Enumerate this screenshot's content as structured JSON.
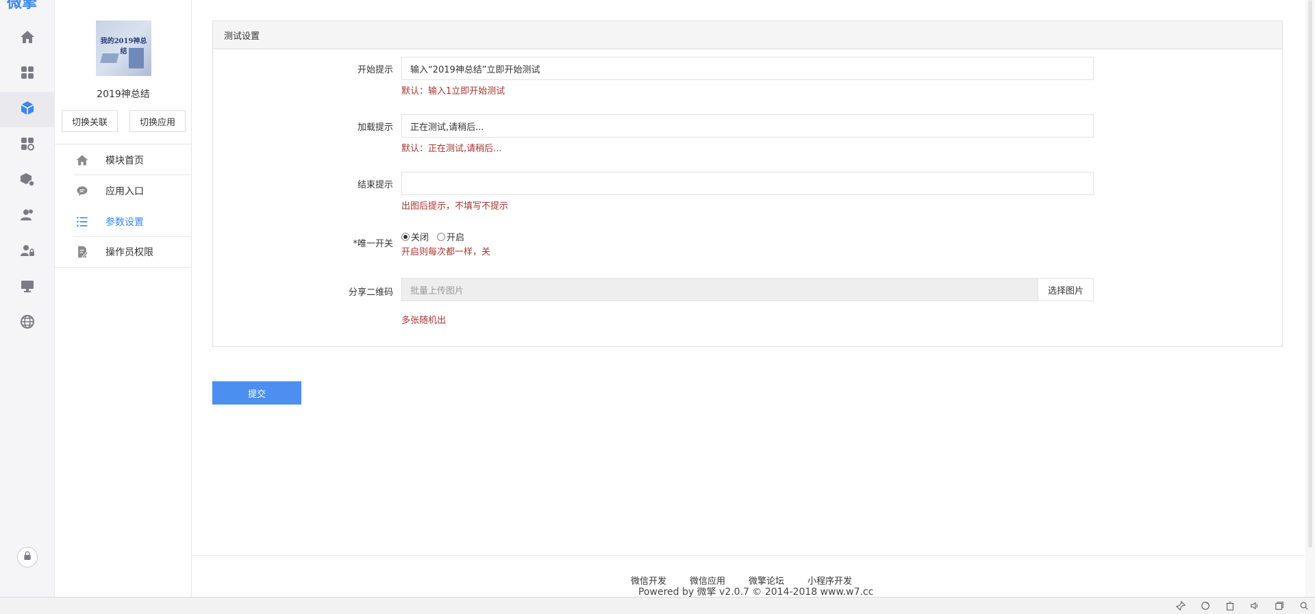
{
  "rail": {
    "logo_text": "微擎",
    "items": [
      "home",
      "apps",
      "module",
      "app-settings",
      "module-manage",
      "users",
      "user-security",
      "monitor",
      "globe"
    ]
  },
  "sidebar": {
    "module_name": "2019神总结",
    "thumb_text": "我的2019神总结",
    "switch_link_label": "切换关联",
    "switch_app_label": "切换应用",
    "nav": [
      {
        "label": "模块首页",
        "icon": "home-icon"
      },
      {
        "label": "应用入口",
        "icon": "chat-bubble-icon"
      },
      {
        "label": "参数设置",
        "icon": "list-settings-icon",
        "active": true
      },
      {
        "label": "操作员权限",
        "icon": "edit-document-icon"
      }
    ]
  },
  "panel": {
    "title": "测试设置",
    "fields": {
      "start": {
        "label": "开始提示",
        "value": "输入“2019神总结”立即开始测试",
        "hint": "默认：输入1立即开始测试"
      },
      "loading": {
        "label": "加载提示",
        "value": "正在测试,请稍后...",
        "hint": "默认：正在测试,请稍后..."
      },
      "end": {
        "label": "结束提示",
        "value": "",
        "hint": "出图后提示，不填写不提示"
      },
      "unique": {
        "label": "*唯一开关",
        "off_label": "关闭",
        "on_label": "开启",
        "selected": "关闭",
        "hint": "开启则每次都一样，关"
      },
      "share_qr": {
        "label": "分享二维码",
        "placeholder": "批量上传图片",
        "button_label": "选择图片",
        "hint": "多张随机出"
      }
    }
  },
  "submit_label": "提交",
  "footer": {
    "links": [
      "微信开发",
      "微信应用",
      "微擎论坛",
      "小程序开发"
    ],
    "powered": "Powered by 微擎 v2.0.7 © 2014-2018 www.w7.cc"
  },
  "colors": {
    "accent": "#3c87f0",
    "submit": "#4c8ff1",
    "hint": "#a7342f"
  }
}
